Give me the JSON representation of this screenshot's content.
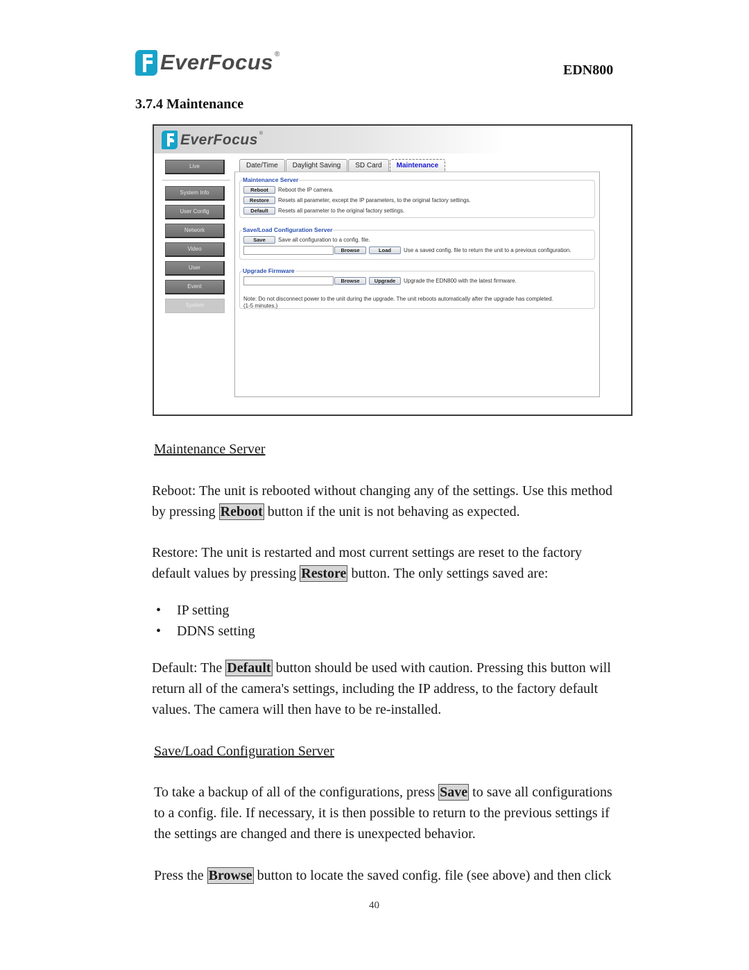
{
  "header": {
    "brand": "EverFocus",
    "brand_mark": "®",
    "model": "EDN800",
    "section_title": "3.7.4 Maintenance"
  },
  "screenshot": {
    "brand": "EverFocus",
    "brand_mark": "®",
    "sidebar": [
      {
        "label": "Live",
        "active": false
      },
      {
        "label": "System Info",
        "active": false
      },
      {
        "label": "User Config",
        "active": false
      },
      {
        "label": "Network",
        "active": false
      },
      {
        "label": "Video",
        "active": false
      },
      {
        "label": "User",
        "active": false
      },
      {
        "label": "Event",
        "active": false
      },
      {
        "label": "System",
        "active": true
      }
    ],
    "tabs": [
      {
        "label": "Date/Time",
        "active": false
      },
      {
        "label": "Daylight Saving",
        "active": false
      },
      {
        "label": "SD Card",
        "active": false
      },
      {
        "label": "Maintenance",
        "active": true
      }
    ],
    "maintenance_server": {
      "legend": "Maintenance Server",
      "rows": [
        {
          "button": "Reboot",
          "description": "Reboot the IP camera."
        },
        {
          "button": "Restore",
          "description": "Resets all parameter, except the IP parameters, to the original factory settings."
        },
        {
          "button": "Default",
          "description": "Resets all parameter to the original factory settings."
        }
      ]
    },
    "save_load": {
      "legend": "Save/Load Configuration Server",
      "save_button": "Save",
      "save_description": "Save all configuration to a config. file.",
      "file_value": "",
      "browse_button": "Browse",
      "load_button": "Load",
      "load_description": "Use a saved config. file to return the unit to a previous configuration."
    },
    "upgrade": {
      "legend": "Upgrade Firmware",
      "file_value": "",
      "browse_button": "Browse",
      "upgrade_button": "Upgrade",
      "upgrade_description": "Upgrade the EDN800 with the latest firmware.",
      "note_line1": "Note: Do not disconnect power to the unit during the upgrade. The unit reboots automatically after the upgrade has completed.",
      "note_line2": "(1-5 minutes.)"
    }
  },
  "body": {
    "maint_heading": "Maintenance Server",
    "reboot_l1": "Reboot: The unit is rebooted without changing any of the settings. Use this method",
    "reboot_l2_pre": "by pressing ",
    "reboot_btn": "Reboot",
    "reboot_l2_post": " button if the unit is not behaving as expected.",
    "restore_l1": "Restore: The unit is restarted and most current settings are reset to the factory",
    "restore_l2_pre": "default values by pressing ",
    "restore_btn": "Restore",
    "restore_l2_post": " button. The only settings saved are:",
    "bullets": [
      "IP setting",
      "DDNS setting"
    ],
    "bullet_char": "•",
    "default_l1_pre": "Default: The ",
    "default_btn": "Default",
    "default_l1_post": " button should be used with caution. Pressing this button will",
    "default_l2": "return all of the camera's settings, including the IP address, to the factory default",
    "default_l3": "values. The camera will then have to be re-installed.",
    "saveload_heading": "Save/Load Configuration Server",
    "save_l1_pre": "To take a backup of all of the configurations, press ",
    "save_btn": "Save",
    "save_l1_post": " to save all configurations",
    "save_l2": "to a config. file. If necessary, it is then possible to return to the previous settings if",
    "save_l3": "the settings are changed and there is unexpected behavior.",
    "browse_l1_pre": "Press the ",
    "browse_btn": "Browse",
    "browse_l1_post": " button to locate the saved config. file (see above) and then click"
  },
  "footer": {
    "page_number": "40"
  }
}
